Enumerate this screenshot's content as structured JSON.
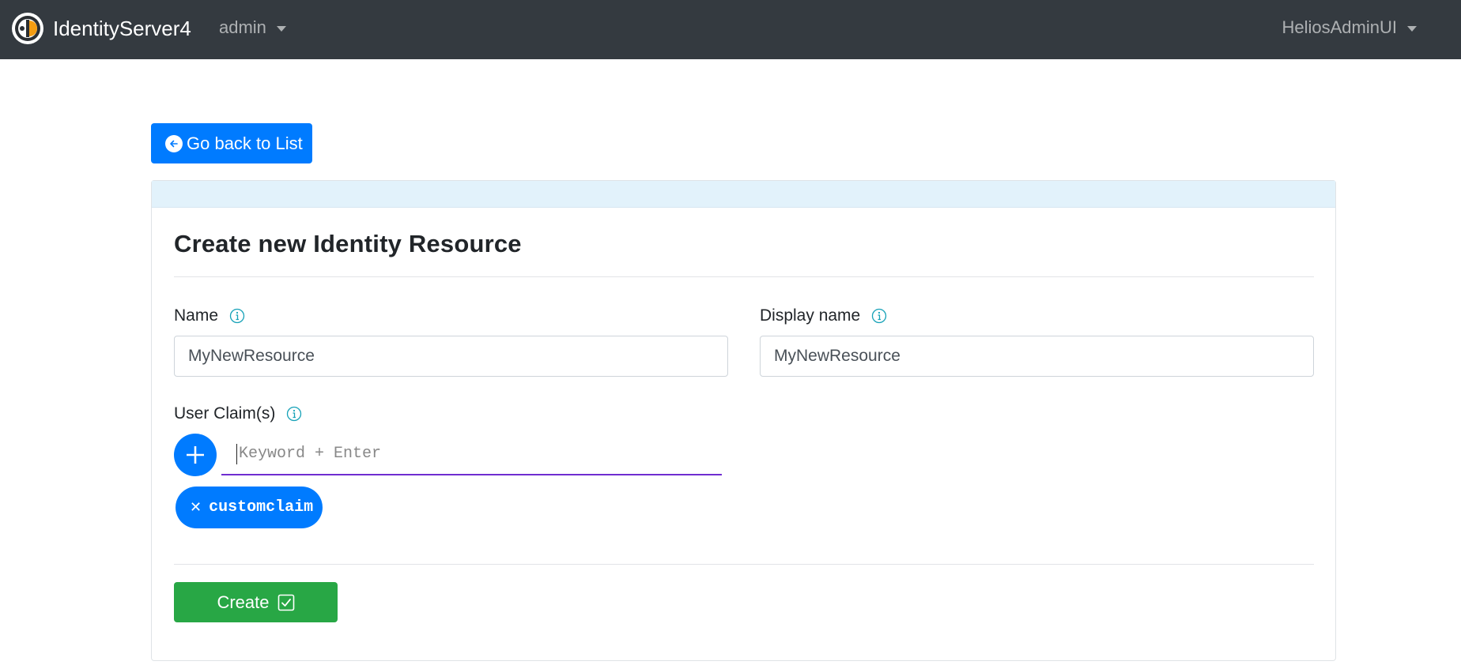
{
  "navbar": {
    "brand": "IdentityServer4",
    "admin_menu": "admin",
    "user_menu": "HeliosAdminUI"
  },
  "back_button": {
    "label": "Go back to List"
  },
  "form": {
    "title": "Create new Identity Resource",
    "name": {
      "label": "Name",
      "value": "MyNewResource"
    },
    "display_name": {
      "label": "Display name",
      "value": "MyNewResource"
    },
    "user_claims": {
      "label": "User Claim(s)",
      "placeholder": "Keyword + Enter",
      "tags": [
        "customclaim"
      ]
    },
    "submit_label": "Create"
  },
  "colors": {
    "navbar_bg": "#343a40",
    "primary": "#007bff",
    "success": "#28a745",
    "card_header_bg": "#e2f2fb",
    "input_focus_underline": "#6f2dd1"
  },
  "icons": {
    "brand": "identityserver-logo-icon",
    "back": "arrow-left-circle-icon",
    "info": "info-circle-icon",
    "add": "plus-icon",
    "remove_tag": "close-icon",
    "create": "check-square-icon"
  }
}
